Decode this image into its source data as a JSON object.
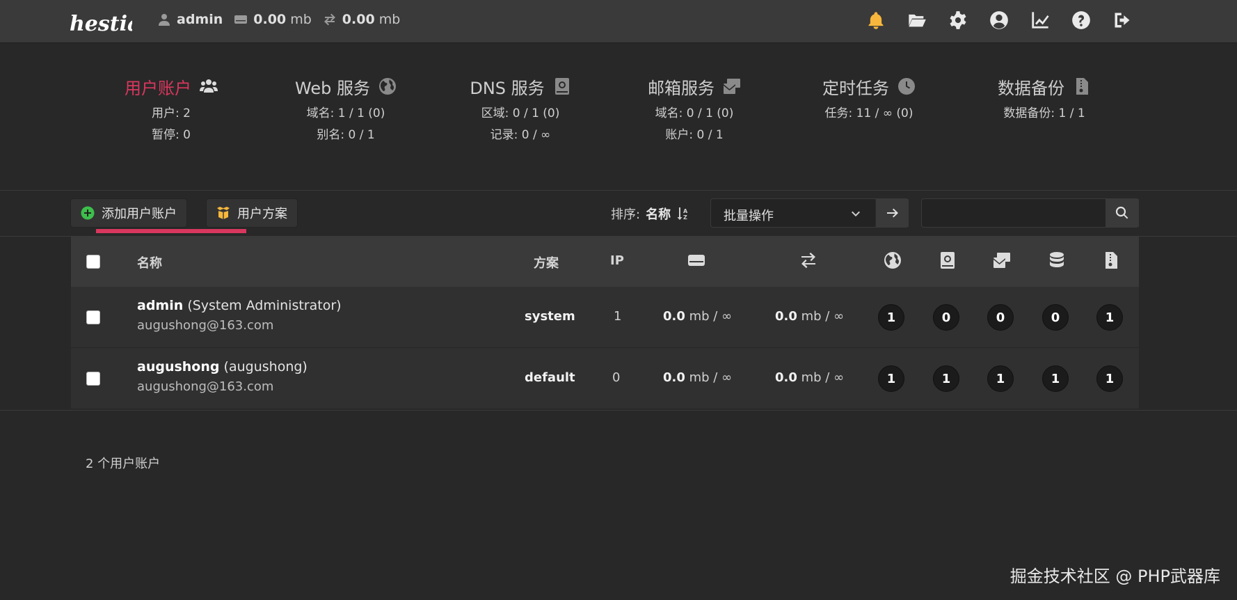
{
  "header": {
    "logo": "hestia",
    "user": "admin",
    "disk_value": "0.00",
    "disk_unit": "mb",
    "bandwidth_value": "0.00",
    "bandwidth_unit": "mb",
    "icons": [
      "bell-icon",
      "folder-icon",
      "gear-icon",
      "user-circle-icon",
      "chart-icon",
      "help-icon",
      "logout-icon"
    ],
    "notification_color": "#f6b73c"
  },
  "services": [
    {
      "title": "用户账户",
      "icon": "users-icon",
      "lines": [
        "用户: 2",
        "暂停: 0"
      ]
    },
    {
      "title": "Web 服务",
      "icon": "globe-icon",
      "lines": [
        "域名: 1 / 1 (0)",
        "别名: 0 / 1"
      ]
    },
    {
      "title": "DNS 服务",
      "icon": "dns-book-icon",
      "lines": [
        "区域: 0 / 1 (0)",
        "记录: 0 / ∞"
      ]
    },
    {
      "title": "邮箱服务",
      "icon": "mail-icon",
      "lines": [
        "域名: 0 / 1 (0)",
        "账户: 0 / 1"
      ]
    },
    {
      "title": "定时任务",
      "icon": "clock-icon",
      "lines": [
        "任务: 11 / ∞ (0)"
      ]
    },
    {
      "title": "数据备份",
      "icon": "backup-file-icon",
      "lines": [
        "数据备份: 1 / 1"
      ]
    }
  ],
  "accent_color": "#d9375e",
  "toolbar": {
    "add_user_label": "添加用户账户",
    "packages_label": "用户方案",
    "sort_label": "排序:",
    "sort_value": "名称",
    "bulk_label": "批量操作",
    "search_placeholder": ""
  },
  "table": {
    "headers": {
      "name": "名称",
      "plan": "方案",
      "ip": "IP"
    },
    "header_icons": [
      "disk-icon",
      "bandwidth-icon",
      "globe-icon",
      "dns-book-icon",
      "mail-icon",
      "database-icon",
      "backup-file-icon"
    ],
    "rows": [
      {
        "username": "admin",
        "fullname": "(System Administrator)",
        "email": "augushong@163.com",
        "plan": "system",
        "ip": "1",
        "disk_value": "0.0",
        "disk_rest": "mb / ∞",
        "bw_value": "0.0",
        "bw_rest": "mb / ∞",
        "counts": [
          "1",
          "0",
          "0",
          "0",
          "1"
        ]
      },
      {
        "username": "augushong",
        "fullname": "(augushong)",
        "email": "augushong@163.com",
        "plan": "default",
        "ip": "0",
        "disk_value": "0.0",
        "disk_rest": "mb / ∞",
        "bw_value": "0.0",
        "bw_rest": "mb / ∞",
        "counts": [
          "1",
          "1",
          "1",
          "1",
          "1"
        ]
      }
    ]
  },
  "footer": {
    "count": "2 个用户账户"
  },
  "watermark": "掘金技术社区 @ PHP武器库"
}
